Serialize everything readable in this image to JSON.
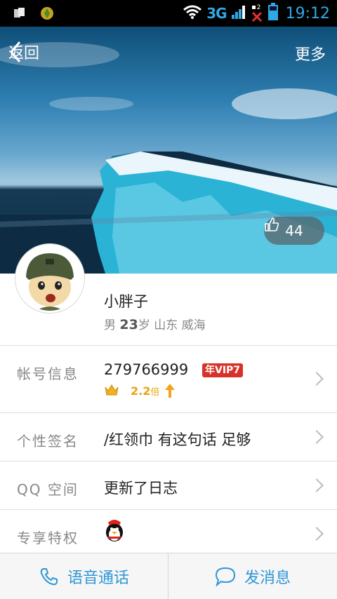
{
  "status_bar": {
    "network": "3G",
    "sim_slot": "2",
    "time": "19:12"
  },
  "header": {
    "back_label": "返回",
    "more_label": "更多"
  },
  "like": {
    "count": "44"
  },
  "profile": {
    "name": "小胖子",
    "gender": "男",
    "age": "23",
    "age_unit": "岁",
    "location": "山东 威海"
  },
  "account": {
    "label": "帐号信息",
    "qq_number": "279766999",
    "vip_prefix": "年",
    "vip_label": "VIP7",
    "multiplier": "2.2",
    "multiplier_unit": "倍"
  },
  "signature": {
    "label": "个性签名",
    "value": "/红领巾 有这句话 足够"
  },
  "qzone": {
    "label_prefix": "QQ",
    "label": "空间",
    "value": "更新了日志"
  },
  "privilege": {
    "label": "专享特权"
  },
  "bottom": {
    "voice_call": "语音通话",
    "send_message": "发消息"
  },
  "colors": {
    "accent": "#2f97d6",
    "vip_red": "#d8312a",
    "gold": "#e8a410"
  }
}
